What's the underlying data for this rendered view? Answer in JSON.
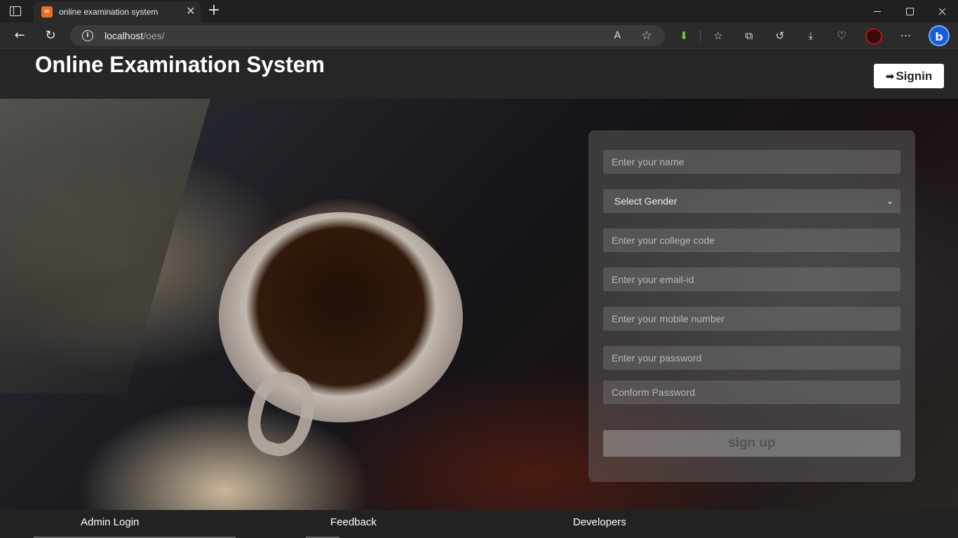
{
  "browser": {
    "tab_title": "online examination system",
    "url_host": "localhost",
    "url_path": "/oes/"
  },
  "header": {
    "title": "Online Examination System",
    "signin_label": "Signin"
  },
  "form": {
    "name_placeholder": "Enter your name",
    "gender_selected": "Select Gender",
    "college_placeholder": "Enter your college code",
    "email_placeholder": "Enter your email-id",
    "mobile_placeholder": "Enter your mobile number",
    "password_placeholder": "Enter your password",
    "confirm_placeholder": "Conform Password",
    "submit_label": "sign up"
  },
  "footer": {
    "links": [
      "Admin Login",
      "Feedback",
      "Developers"
    ]
  },
  "colors": {
    "header_bg": "#262626",
    "footer_bg": "#222222",
    "panel_bg": "rgba(120,120,120,0.38)"
  },
  "icons": {
    "signin": "signin-arrow-icon",
    "gender_dropdown": "chevron-down-icon"
  }
}
